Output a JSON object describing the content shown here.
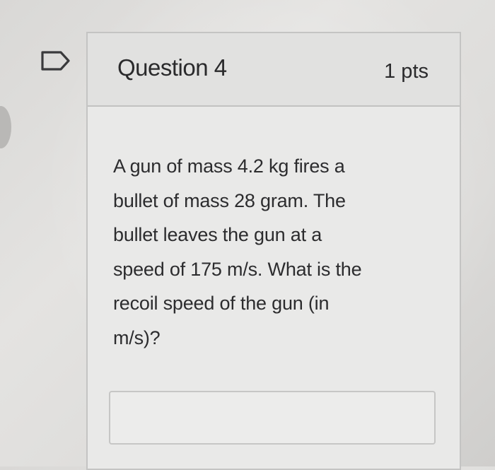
{
  "question": {
    "title": "Question 4",
    "points": "1 pts",
    "body_lines": [
      "A gun of mass 4.2 kg fires a",
      "bullet of mass 28 gram. The",
      "bullet leaves the gun at a",
      "speed of 175 m/s. What is the",
      "recoil speed of the gun (in",
      "m/s)?"
    ],
    "answer_value": "",
    "flag_icon": "flag-outline-icon"
  },
  "colors": {
    "text": "#2a2a2c",
    "card_background": "#e9e9e8",
    "header_background": "#e1e1e0",
    "border": "#c4c4c3"
  }
}
